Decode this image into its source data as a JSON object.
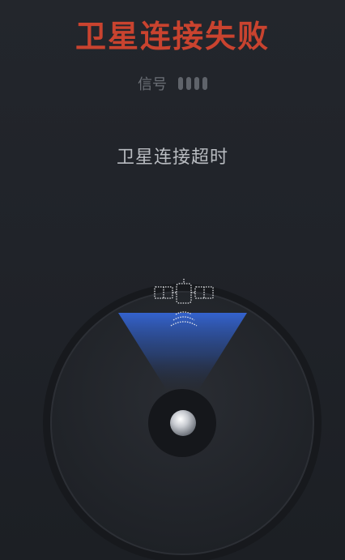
{
  "header": {
    "title": "卫星连接失败"
  },
  "signal": {
    "label": "信号",
    "bars_total": 4,
    "bars_active": 0
  },
  "status": {
    "message": "卫星连接超时"
  },
  "icons": {
    "satellite": "satellite-icon",
    "knob": "knob-center-icon"
  },
  "colors": {
    "title": "#c9432f",
    "beam": "#2f5fc8",
    "background": "#202329"
  }
}
